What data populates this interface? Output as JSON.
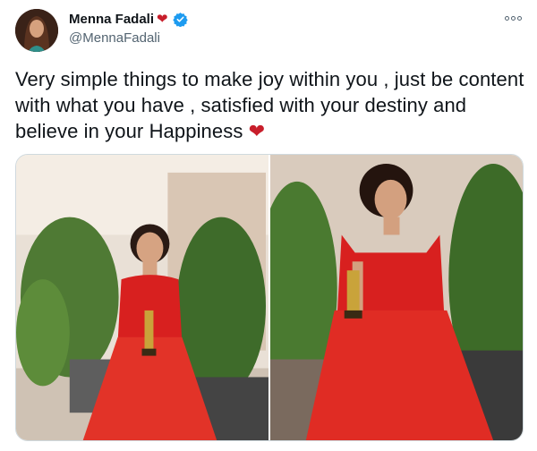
{
  "author": {
    "display_name": "Menna Fadali",
    "name_emoji": "❤",
    "handle": "@MennaFadali",
    "verified": true,
    "avatar_icon": "avatar-portrait"
  },
  "tweet": {
    "text": "Very simple things to make joy within you , just be content with what you have , satisfied with your destiny and believe in your Happiness",
    "trailing_emoji": "❤"
  },
  "media": {
    "photos": [
      {
        "icon": "photo-woman-red-dress-with-award"
      },
      {
        "icon": "photo-woman-red-dress-with-award-closeup"
      }
    ]
  },
  "colors": {
    "accent_blue": "#1d9bf0",
    "heart_red": "#c81e2b",
    "dress_red": "#d8201f",
    "text": "#0f1419",
    "muted": "#536471"
  },
  "icons": {
    "more": "more-options-icon",
    "verified": "verified-badge-icon"
  }
}
